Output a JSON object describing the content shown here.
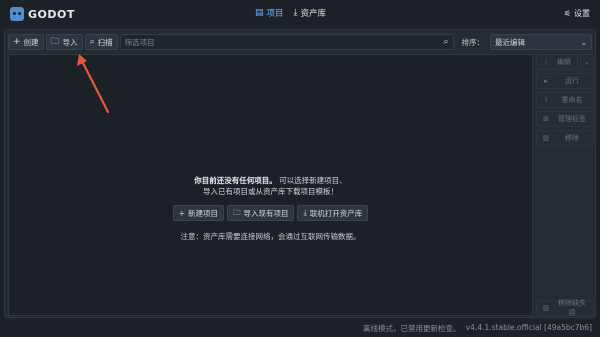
{
  "app": {
    "name": "GODOT"
  },
  "topnav": {
    "projects_label": "项目",
    "assetlib_label": "资产库",
    "settings_label": "设置"
  },
  "toolbar": {
    "create_label": "创建",
    "import_label": "导入",
    "scan_label": "扫描",
    "filter_placeholder": "筛选项目",
    "sort_label": "排序：",
    "sort_value": "最近编辑"
  },
  "empty_state": {
    "line1_bold": "你目前还没有任何项目。",
    "line1_rest": "可以选择新建项目、",
    "line2": "导入已有项目或从资产库下载项目模板！",
    "buttons": {
      "new_project": "新建项目",
      "import_existing": "导入现有项目",
      "open_assetlib": "联机打开资产库"
    },
    "note": "注意：资产库需要连接网络，会通过互联网传输数据。"
  },
  "sidebar": {
    "edit": "编辑",
    "run": "运行",
    "rename": "重命名",
    "manage_tags": "管理标签",
    "remove": "移除",
    "remove_missing": "移除缺失项"
  },
  "status": {
    "message": "离线模式，已禁用更新检查。",
    "version": "v4.4.1.stable.official [49a5bc7b6]"
  },
  "colors": {
    "accent": "#6fb2ff",
    "annotation_arrow": "#e8563a"
  },
  "icons": {
    "logo": "godot-logo-icon",
    "projects": "project-list-icon",
    "assetlib": "download-icon",
    "settings": "settings-sliders-icon",
    "create": "plus-icon",
    "import": "folder-icon",
    "scan": "search-icon",
    "filter": "search-icon",
    "sort": "chevron-down-icon"
  }
}
